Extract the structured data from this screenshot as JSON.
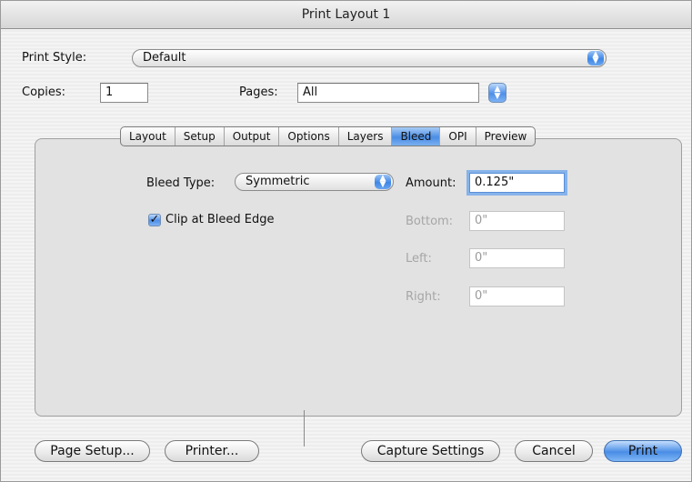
{
  "window": {
    "title": "Print Layout 1"
  },
  "print_style": {
    "label": "Print Style:",
    "value": "Default"
  },
  "copies": {
    "label": "Copies:",
    "value": "1"
  },
  "pages": {
    "label": "Pages:",
    "value": "All"
  },
  "tabs": [
    {
      "label": "Layout",
      "selected": false
    },
    {
      "label": "Setup",
      "selected": false
    },
    {
      "label": "Output",
      "selected": false
    },
    {
      "label": "Options",
      "selected": false
    },
    {
      "label": "Layers",
      "selected": false
    },
    {
      "label": "Bleed",
      "selected": true
    },
    {
      "label": "OPI",
      "selected": false
    },
    {
      "label": "Preview",
      "selected": false
    }
  ],
  "bleed": {
    "type_label": "Bleed Type:",
    "type_value": "Symmetric",
    "clip_label": "Clip at Bleed Edge",
    "clip_checked": true,
    "amount_label": "Amount:",
    "amount_value": "0.125\"",
    "bottom_label": "Bottom:",
    "bottom_value": "0\"",
    "left_label": "Left:",
    "left_value": "0\"",
    "right_label": "Right:",
    "right_value": "0\""
  },
  "buttons": {
    "page_setup": "Page Setup...",
    "printer": "Printer...",
    "capture_settings": "Capture Settings",
    "cancel": "Cancel",
    "print": "Print"
  },
  "colors": {
    "accent": "#4a8de4",
    "disabled_text": "#a6a6a6"
  }
}
